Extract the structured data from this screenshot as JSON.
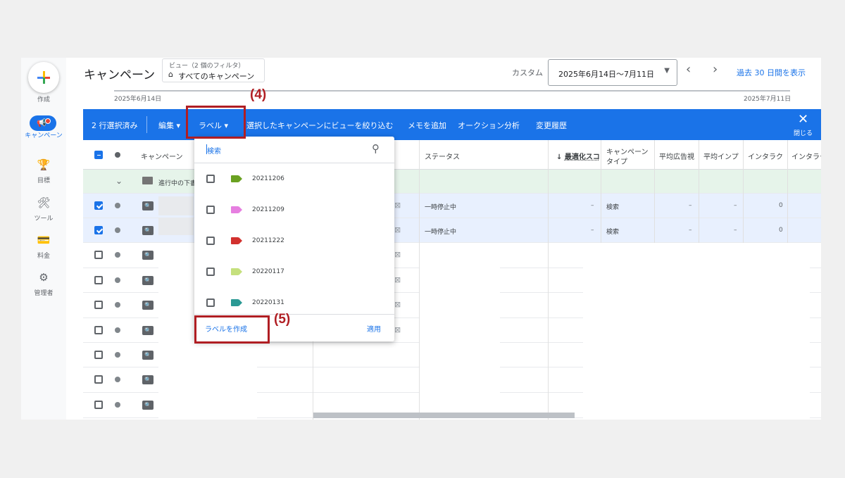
{
  "nav": {
    "create": "作成",
    "campaigns": "キャンペーン",
    "goals": "目標",
    "tools": "ツール",
    "billing": "料金",
    "admin": "管理者"
  },
  "header": {
    "title": "キャンペーン",
    "view_small": "ビュー（2 個のフィルタ）",
    "view_main": "すべてのキャンペーン",
    "custom": "カスタム",
    "date_range": "2025年6月14日〜7月11日",
    "show_30": "過去 30 日間を表示"
  },
  "timeline": {
    "start": "2025年6月14日",
    "end": "2025年7月11日"
  },
  "actionbar": {
    "selected": "2 行選択済み",
    "edit": "編集",
    "label": "ラベル",
    "filter_view": "選択したキャンペーンにビューを絞り込む",
    "add_memo": "メモを追加",
    "auction": "オークション分析",
    "history": "変更履歴",
    "close": "閉じる"
  },
  "annotations": {
    "step4": "(4)",
    "step5": "(5)"
  },
  "table": {
    "headers": {
      "campaign": "キャンペーン",
      "status": "ステータス",
      "opt_score": "最適化スコ",
      "campaign_type_1": "キャンペーン",
      "campaign_type_2": "タイプ",
      "avg_view": "平均広告視",
      "avg_imp": "平均インプ",
      "interactions": "インタラク",
      "interaction_rate": "インタラク"
    },
    "group_row": "進行中の下書",
    "rows": [
      {
        "status": "一時停止中",
        "opt": "–",
        "type": "検索",
        "v1": "–",
        "v2": "–",
        "inter": "0"
      },
      {
        "status": "一時停止中",
        "opt": "–",
        "type": "検索",
        "v1": "–",
        "v2": "–",
        "inter": "0"
      }
    ]
  },
  "dropdown": {
    "search_placeholder": "検索",
    "labels": [
      {
        "name": "20211206",
        "color": "#6aa121"
      },
      {
        "name": "20211209",
        "color": "#e67fe0"
      },
      {
        "name": "20211222",
        "color": "#d2312e"
      },
      {
        "name": "20220117",
        "color": "#c5e07d"
      },
      {
        "name": "20220131",
        "color": "#2a9994"
      }
    ],
    "create": "ラベルを作成",
    "apply": "適用"
  },
  "colors": {
    "accent": "#1a73e8",
    "highlight": "#b01e23"
  }
}
